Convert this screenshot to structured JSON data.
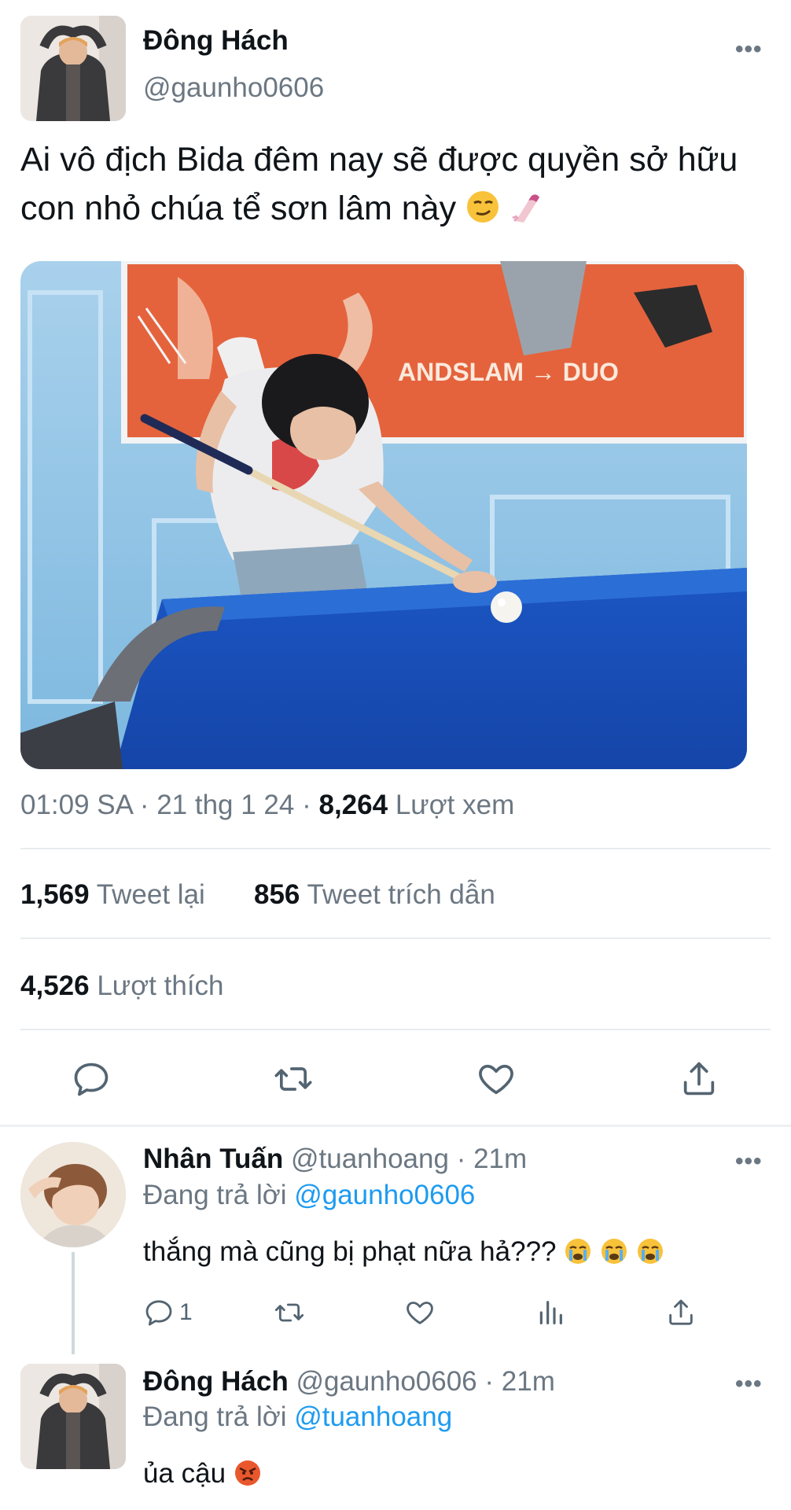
{
  "main_tweet": {
    "author_name": "Đông Hách",
    "author_handle": "@gaunho0606",
    "more_label": "•••",
    "text": "Ai vô địch Bida đêm nay sẽ được quyền sở hữu con nhỏ chúa tể sơn lâm này",
    "image_text": "ANDSLAM → DUO",
    "time": "01:09 SA",
    "date": "21 thg 1 24",
    "views_count": "8,264",
    "views_label": "Lượt xem",
    "retweets_count": "1,569",
    "retweets_label": "Tweet lại",
    "quotes_count": "856",
    "quotes_label": "Tweet trích dẫn",
    "likes_count": "4,526",
    "likes_label": "Lượt thích"
  },
  "replies": [
    {
      "author_name": "Nhân Tuấn",
      "author_handle": "@tuanhoang",
      "time": "· 21m",
      "replying_prefix": "Đang trả lời",
      "replying_to": "@gaunho0606",
      "text": "thắng mà cũng bị phạt nữa hả???",
      "reply_count": "1",
      "more_label": "•••"
    },
    {
      "author_name": "Đông Hách",
      "author_handle": "@gaunho0606",
      "time": "· 21m",
      "replying_prefix": "Đang trả lời",
      "replying_to": "@tuanhoang",
      "text": "ủa cậu",
      "more_label": "•••"
    }
  ],
  "colors": {
    "accent": "#1d9bf0",
    "secondary_text": "#6b7782",
    "primary_text": "#0f1419"
  },
  "icons": [
    "reply-icon",
    "retweet-icon",
    "like-icon",
    "share-icon",
    "analytics-icon",
    "more-icon"
  ]
}
